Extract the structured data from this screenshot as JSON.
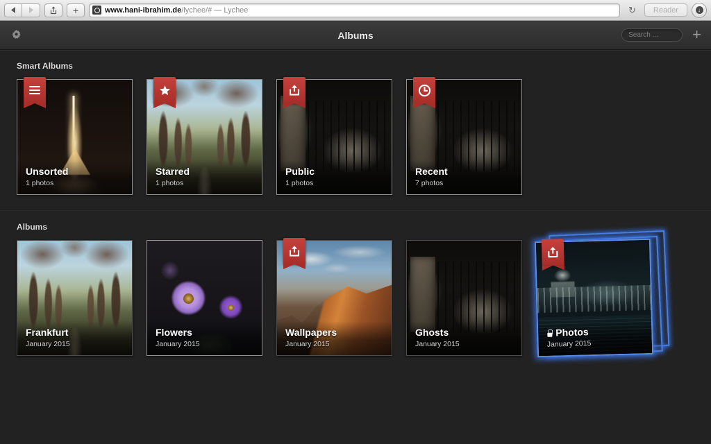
{
  "browser": {
    "back_label": "◀",
    "forward_label": "▶",
    "share_label": "share",
    "new_tab_label": "+",
    "url_host": "www.hani-ibrahim.de",
    "url_path": "/lychee/# — Lychee",
    "reload_label": "↻",
    "reader_label": "Reader",
    "downloads_label": "↓"
  },
  "header": {
    "title": "Albums",
    "settings_icon": "gear-icon",
    "search_placeholder": "Search ...",
    "add_label": "+"
  },
  "accent_color": "#b8352f",
  "selection_color": "#4a7fe0",
  "sections": [
    {
      "title": "Smart Albums",
      "albums": [
        {
          "name": "Unsorted",
          "sub": "1 photos",
          "badge": "bars-icon",
          "thumb": "t-eiffel",
          "selected": true,
          "locked": false
        },
        {
          "name": "Starred",
          "sub": "1 photos",
          "badge": "star-icon",
          "thumb": "t-trees",
          "selected": false,
          "locked": false
        },
        {
          "name": "Public",
          "sub": "1 photos",
          "badge": "share-icon",
          "thumb": "t-gate",
          "selected": false,
          "locked": false
        },
        {
          "name": "Recent",
          "sub": "7 photos",
          "badge": "clock-icon",
          "thumb": "t-gate",
          "selected": false,
          "locked": false
        }
      ]
    },
    {
      "title": "Albums",
      "albums": [
        {
          "name": "Frankfurt",
          "sub": "January 2015",
          "badge": null,
          "thumb": "t-trees",
          "selected": false,
          "locked": false,
          "dragging": false
        },
        {
          "name": "Flowers",
          "sub": "January 2015",
          "badge": null,
          "thumb": "t-flower",
          "selected": true,
          "locked": false,
          "dragging": false
        },
        {
          "name": "Wallpapers",
          "sub": "January 2015",
          "badge": "share-icon",
          "thumb": "t-canyon",
          "selected": false,
          "locked": false,
          "dragging": false
        },
        {
          "name": "Ghosts",
          "sub": "January 2015",
          "badge": null,
          "thumb": "t-gate",
          "selected": false,
          "locked": false,
          "dragging": false
        },
        {
          "name": "Photos",
          "sub": "January 2015",
          "badge": "share-icon",
          "thumb": "t-city",
          "selected": true,
          "locked": true,
          "dragging": true
        }
      ]
    }
  ]
}
